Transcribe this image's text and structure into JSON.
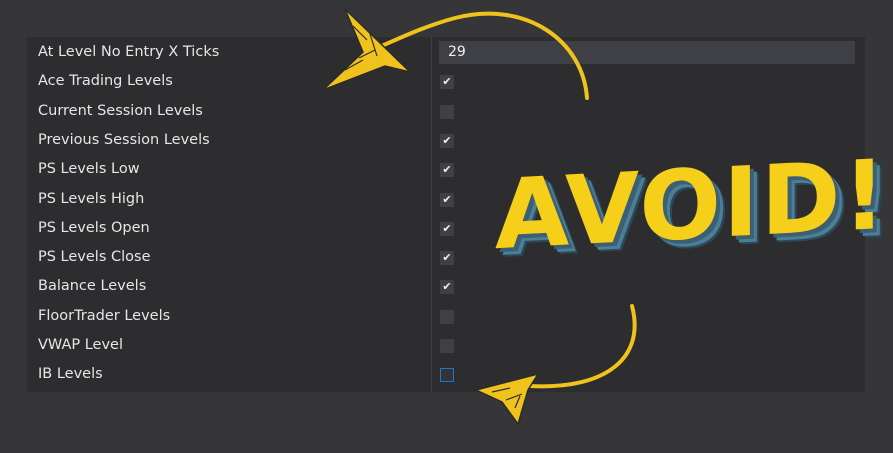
{
  "settings": [
    {
      "label": "At Level No Entry X Ticks",
      "type": "number",
      "value": "29"
    },
    {
      "label": "Ace Trading Levels",
      "type": "checkbox",
      "checked": true
    },
    {
      "label": "Current Session Levels",
      "type": "checkbox",
      "checked": false
    },
    {
      "label": "Previous Session Levels",
      "type": "checkbox",
      "checked": true
    },
    {
      "label": "PS Levels Low",
      "type": "checkbox",
      "checked": true
    },
    {
      "label": "PS Levels High",
      "type": "checkbox",
      "checked": true
    },
    {
      "label": "PS Levels Open",
      "type": "checkbox",
      "checked": true
    },
    {
      "label": "PS Levels Close",
      "type": "checkbox",
      "checked": true
    },
    {
      "label": "Balance Levels",
      "type": "checkbox",
      "checked": true
    },
    {
      "label": "FloorTrader Levels",
      "type": "checkbox",
      "checked": false
    },
    {
      "label": "VWAP Level",
      "type": "checkbox",
      "checked": false
    },
    {
      "label": "IB Levels",
      "type": "checkbox",
      "checked": false,
      "focused": true
    }
  ],
  "overlay": {
    "text": "AVOID!",
    "text_color": "#f5cf19",
    "shadow_color": "#4b7f98",
    "arrow_color": "#f0c21c"
  },
  "check_glyph": "✔",
  "colors": {
    "background": "#363638",
    "panel": "#2d2d30",
    "input": "#3f3f46",
    "focus_border": "#1e78c8"
  }
}
